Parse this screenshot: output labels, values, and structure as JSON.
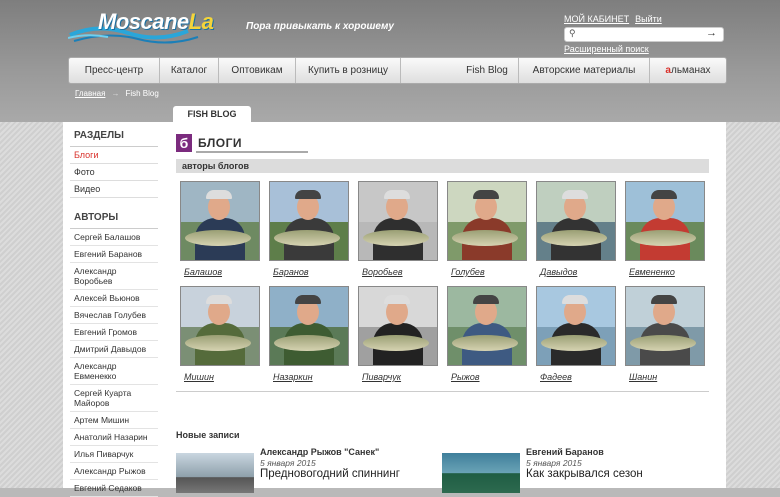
{
  "header": {
    "logo_text": "Moscanela",
    "logo_main": "Moscane",
    "logo_accent": "La",
    "slogan": "Пора привыкать к хорошему",
    "links": [
      "МОЙ КАБИНЕТ",
      "Выйти"
    ],
    "search_placeholder": "",
    "advanced_search": "Расширенный поиск"
  },
  "nav": [
    "Пресс-центр",
    "Каталог",
    "Оптовикам",
    "Купить в розницу",
    "Fish Blog",
    "Авторские материалы",
    "альманах"
  ],
  "nav_almanac_prefix": "а",
  "nav_almanac_rest": "льманах",
  "breadcrumb": {
    "home": "Главная",
    "arrow": "→",
    "current": "Fish Blog"
  },
  "tab": "FISH BLOG",
  "sidebar": {
    "sections_title": "РАЗДЕЛЫ",
    "sections": [
      "Блоги",
      "Фото",
      "Видео"
    ],
    "authors_title": "АВТОРЫ",
    "authors": [
      "Сергей Балашов",
      "Евгений Баранов",
      "Александр Воробьев",
      "Алексей Вьюнов",
      "Вячеслав Голубев",
      "Евгений Громов",
      "Дмитрий Давыдов",
      "Александр Евменекко",
      "Сергей Куарта Майоров",
      "Артем Мишин",
      "Анатолий Назарин",
      "Илья Пиварчук",
      "Александр Рыжов",
      "Евгений Седаков"
    ]
  },
  "main": {
    "icon_letter": "б",
    "title": "БЛОГИ",
    "subtitle": "авторы блогов",
    "bloggers": [
      "Балашов",
      "Баранов",
      "Воробьев",
      "Голубев",
      "Давыдов",
      "Евмененко",
      "Мишин",
      "Назаркин",
      "Пиварчук",
      "Рыжов",
      "Фадеев",
      "Шанин"
    ],
    "new_posts_title": "Новые записи",
    "posts": [
      {
        "author": "Александр Рыжов \"Санек\"",
        "date": "5 января 2015",
        "title": "Предновогодний спиннинг"
      },
      {
        "author": "Евгений Баранов",
        "date": "5 января 2015",
        "title": "Как закрывался сезон"
      }
    ]
  },
  "colors": {
    "accent_red": "#d9302a",
    "blog_icon": "#7b2b7e"
  }
}
